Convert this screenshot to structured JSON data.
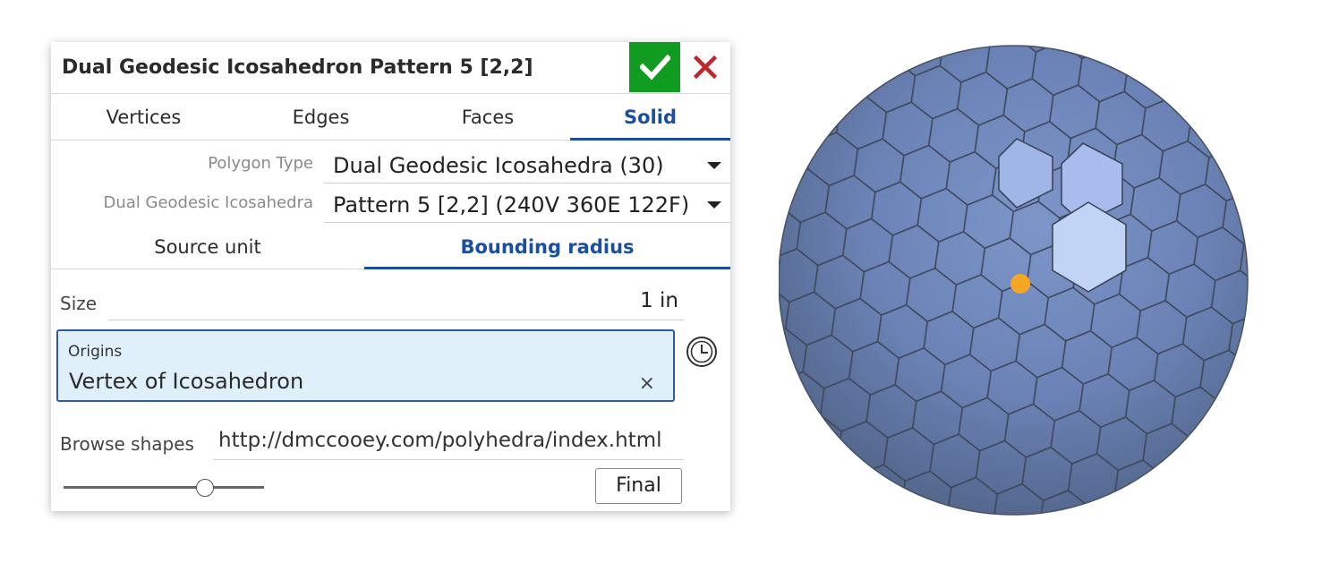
{
  "dialog": {
    "title": "Dual Geodesic Icosahedron Pattern 5 [2,2]",
    "ok_icon": "checkmark-icon",
    "cancel_icon": "close-icon"
  },
  "tabs": [
    {
      "label": "Vertices",
      "active": false
    },
    {
      "label": "Edges",
      "active": false
    },
    {
      "label": "Faces",
      "active": false
    },
    {
      "label": "Solid",
      "active": true
    }
  ],
  "polygon_type": {
    "label": "Polygon Type",
    "value": "Dual Geodesic Icosahedra (30)"
  },
  "pattern": {
    "label": "Dual Geodesic Icosahedra",
    "value": "Pattern 5 [2,2] (240V 360E 122F)"
  },
  "subtabs": [
    {
      "label": "Source unit",
      "active": false
    },
    {
      "label": "Bounding radius",
      "active": true
    }
  ],
  "size": {
    "label": "Size",
    "value": "1 in"
  },
  "origins": {
    "label": "Origins",
    "value": "Vertex of Icosahedron",
    "clear_icon": "×"
  },
  "browse": {
    "label": "Browse shapes",
    "value": "http://dmccooey.com/polyhedra/index.html"
  },
  "slider": {
    "value": 0.7
  },
  "final_button": "Final",
  "colors": {
    "accent": "#1a4e9e",
    "ok_green": "#0f9c20",
    "cancel_red": "#c0272d",
    "origins_bg": "#dff0fa",
    "solid_face": "#6f87bb",
    "highlight_face": "#b8ccf2",
    "origin_point": "#f5a623"
  }
}
